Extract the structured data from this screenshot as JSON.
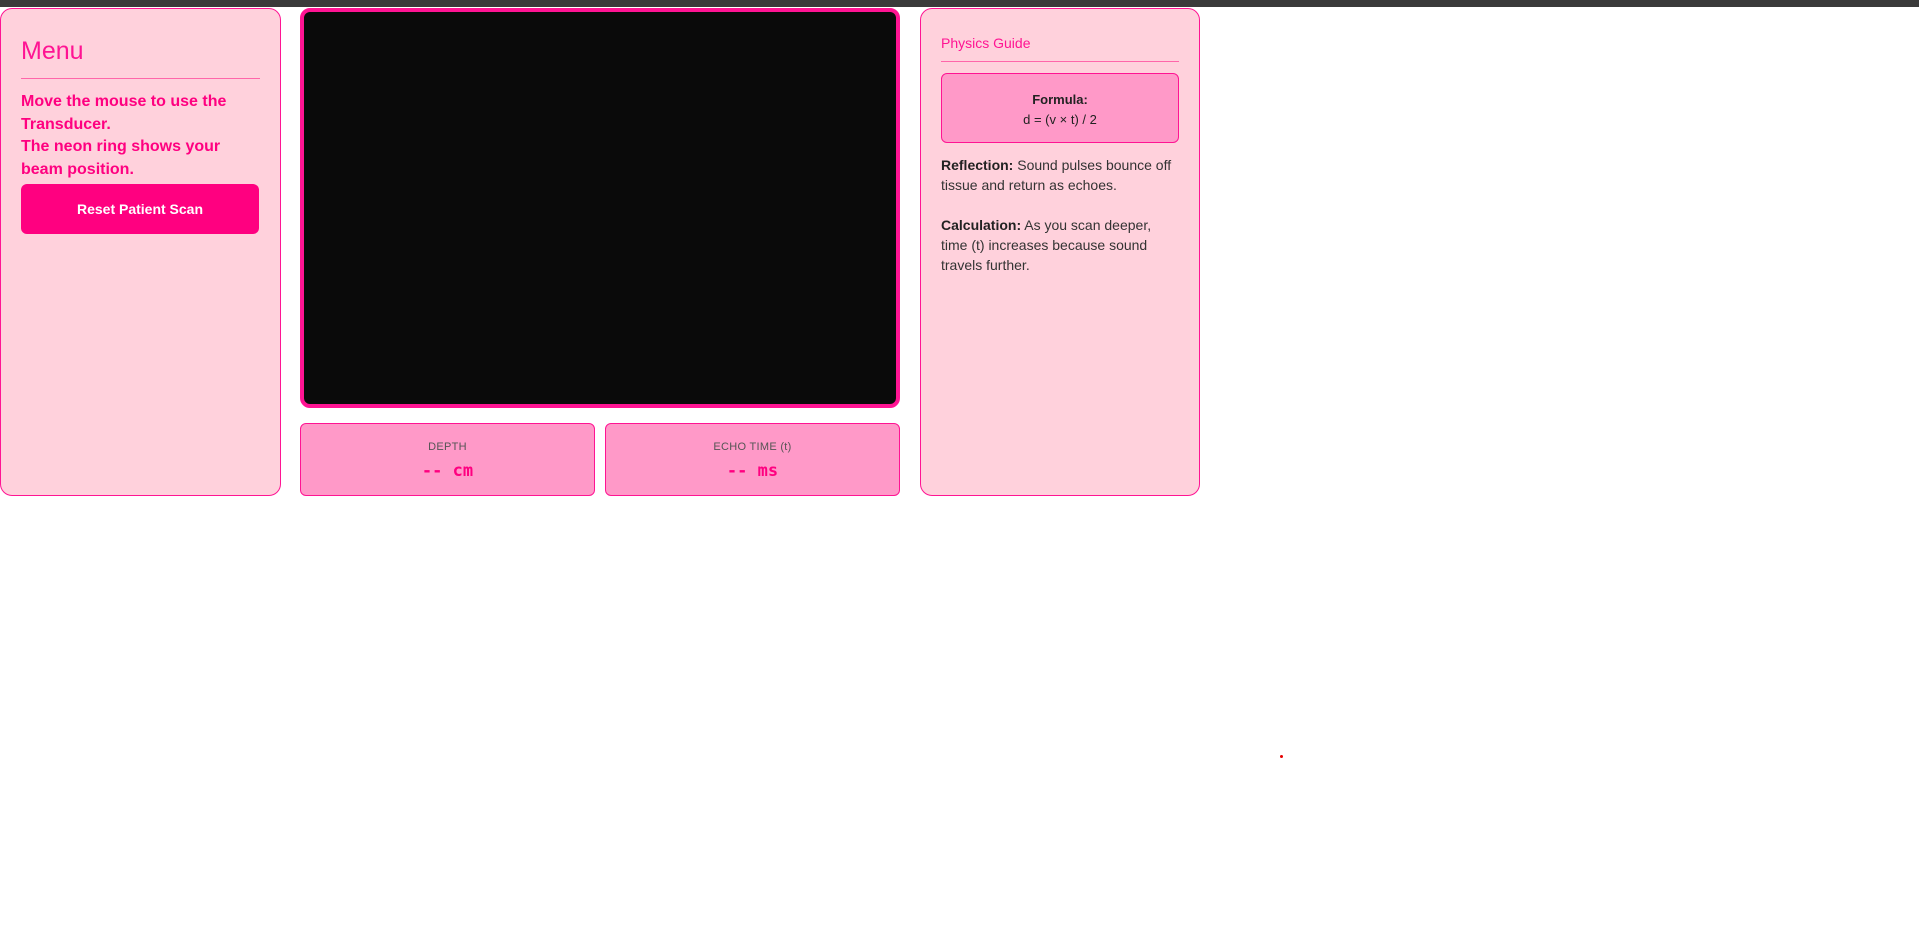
{
  "menu": {
    "title": "Menu",
    "instruction_1": "Move the mouse to use the Transducer.",
    "instruction_2": "The neon ring shows your beam position.",
    "reset_label": "Reset Patient Scan"
  },
  "readouts": {
    "depth_label": "DEPTH",
    "depth_value": "-- cm",
    "echo_label": "ECHO TIME (t)",
    "echo_value": "-- ms"
  },
  "guide": {
    "title": "Physics Guide",
    "formula_label": "Formula:",
    "formula": "d = (v × t) / 2",
    "reflection_label": "Reflection:",
    "reflection_text": " Sound pulses bounce off tissue and return as echoes.",
    "calculation_label": "Calculation:",
    "calculation_text": " As you scan deeper, time (t) increases because sound travels further."
  },
  "colors": {
    "accent": "#ff1493",
    "button": "#ff0080",
    "panel_bg": "#ffd1dc",
    "readout_bg": "#ff99c8",
    "scan_bg": "#0a0a0a"
  }
}
